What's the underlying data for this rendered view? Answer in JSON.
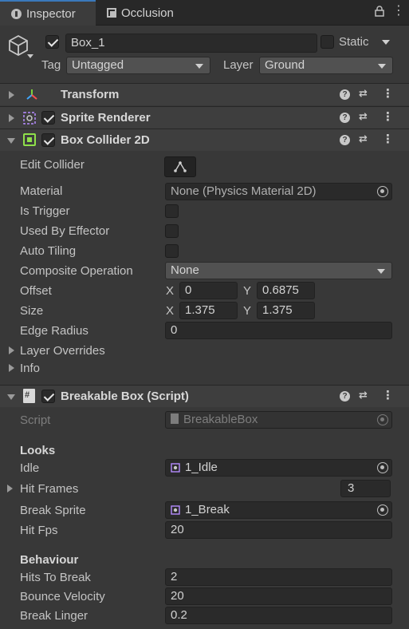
{
  "tabs": [
    {
      "label": "Inspector",
      "icon": "info-icon",
      "active": true
    },
    {
      "label": "Occlusion",
      "icon": "occlusion-icon",
      "active": false
    }
  ],
  "object": {
    "name": "Box_1",
    "active": true,
    "static_label": "Static",
    "static": false,
    "tag_label": "Tag",
    "tag_value": "Untagged",
    "layer_label": "Layer",
    "layer_value": "Ground"
  },
  "components": {
    "transform": {
      "title": "Transform"
    },
    "sprite_renderer": {
      "title": "Sprite Renderer",
      "enabled": true
    },
    "box_collider": {
      "title": "Box Collider 2D",
      "enabled": true,
      "edit_collider_label": "Edit Collider",
      "material_label": "Material",
      "material_value": "None (Physics Material 2D)",
      "is_trigger_label": "Is Trigger",
      "used_by_effector_label": "Used By Effector",
      "auto_tiling_label": "Auto Tiling",
      "composite_label": "Composite Operation",
      "composite_value": "None",
      "offset_label": "Offset",
      "offset_x": "0",
      "offset_y": "0.6875",
      "size_label": "Size",
      "size_x": "1.375",
      "size_y": "1.375",
      "edge_radius_label": "Edge Radius",
      "edge_radius_value": "0",
      "layer_overrides_label": "Layer Overrides",
      "info_label": "Info",
      "x_label": "X",
      "y_label": "Y"
    },
    "breakable_box": {
      "title": "Breakable Box (Script)",
      "enabled": true,
      "script_label": "Script",
      "script_value": "BreakableBox",
      "looks_header": "Looks",
      "idle_label": "Idle",
      "idle_value": "1_Idle",
      "hit_frames_label": "Hit Frames",
      "hit_frames_value": "3",
      "break_sprite_label": "Break Sprite",
      "break_sprite_value": "1_Break",
      "hit_fps_label": "Hit Fps",
      "hit_fps_value": "20",
      "behaviour_header": "Behaviour",
      "hits_to_break_label": "Hits To Break",
      "hits_to_break_value": "2",
      "bounce_velocity_label": "Bounce Velocity",
      "bounce_velocity_value": "20",
      "break_linger_label": "Break Linger",
      "break_linger_value": "0.2"
    }
  },
  "colors": {
    "background": "#383838",
    "tab_accent": "#3a79bb",
    "collider_icon": "#8fe04a",
    "transform_icon": "#3fa7ff"
  }
}
